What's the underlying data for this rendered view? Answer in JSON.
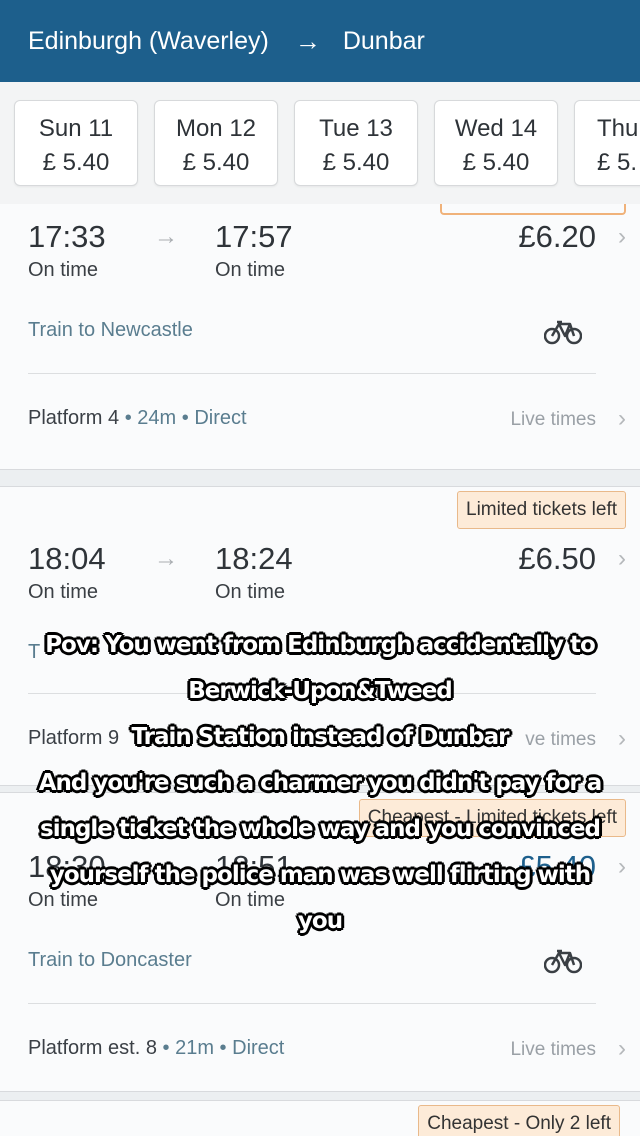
{
  "header": {
    "origin": "Edinburgh (Waverley)",
    "arrow": "→",
    "destination": "Dunbar"
  },
  "dates": [
    {
      "day": "Sun 11",
      "price": "£ 5.40"
    },
    {
      "day": "Mon 12",
      "price": "£ 5.40"
    },
    {
      "day": "Tue 13",
      "price": "£ 5.40"
    },
    {
      "day": "Wed 14",
      "price": "£ 5.40"
    },
    {
      "day": "Thu",
      "price": "£ 5."
    }
  ],
  "journeys": [
    {
      "depart": "17:33",
      "depart_status": "On time",
      "arrive": "17:57",
      "arrive_status": "On time",
      "fare": "£6.20",
      "train": "Train to Newcastle",
      "platform": "Platform 4",
      "duration": "24m",
      "type": "Direct",
      "live": "Live times"
    },
    {
      "tag": "Limited tickets left",
      "depart": "18:04",
      "depart_status": "On time",
      "arrive": "18:24",
      "arrive_status": "On time",
      "fare": "£6.50",
      "train_partial": "T",
      "platform": "Platform 9",
      "live": "ve times"
    },
    {
      "tag": "Cheapest - Limited tickets left",
      "depart": "18:30",
      "depart_status": "On time",
      "arrive": "18:51",
      "arrive_status": "On time",
      "fare": "£5.40",
      "train": "Train to Doncaster",
      "platform": "Platform est. 8",
      "duration": "21m",
      "type": "Direct",
      "live": "Live times"
    },
    {
      "tag": "Cheapest - Only 2 left"
    }
  ],
  "separator": "•",
  "chevron": "›",
  "caption": [
    "Pov: You went from Edinburgh accidentally to",
    "Berwick-Upon&Tweed",
    "Train Station instead of Dunbar",
    "And you're such a charmer you didn't pay for a",
    "single ticket the whole way and  you convinced",
    "yourself the police man was well flirting with",
    "you"
  ],
  "colors": {
    "header": "#1d5f8c",
    "tag_bg": "#fdebd8",
    "tag_border": "#e9b98a",
    "link_text": "#5a7d8f"
  },
  "icons": {
    "arrow": "right-arrow-icon",
    "bike": "bicycle-icon",
    "chevron": "chevron-right-icon"
  }
}
